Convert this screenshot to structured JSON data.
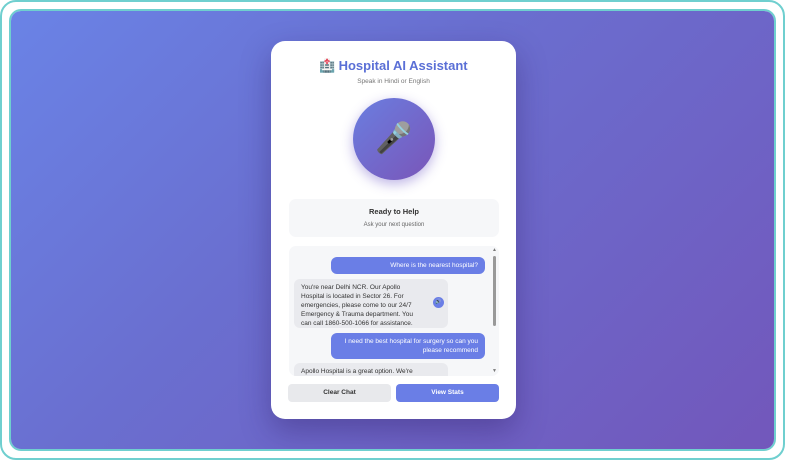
{
  "header": {
    "icon": "hospital-icon",
    "icon_glyph": "🏥",
    "title": "Hospital AI Assistant",
    "subtitle": "Speak in Hindi or English"
  },
  "mic": {
    "icon": "microphone-icon",
    "glyph": "🎤"
  },
  "status": {
    "title": "Ready to Help",
    "subtitle": "Ask your next question"
  },
  "chat": {
    "messages": [
      {
        "role": "user",
        "text": "Where is the nearest hospital?"
      },
      {
        "role": "assistant",
        "text": "You're near Delhi NCR. Our Apollo Hospital is located in Sector 26. For emergencies, please come to our 24/7 Emergency & Trauma department. You can call 1860-500-1066 for assistance.",
        "speaker_glyph": "🔊"
      },
      {
        "role": "user",
        "text": "I need the best hospital for surgery so can you please recommend"
      },
      {
        "role": "assistant",
        "text": "Apollo Hospital is a great option. We're"
      }
    ],
    "scroll_up_glyph": "▲",
    "scroll_down_glyph": "▼"
  },
  "actions": {
    "clear_label": "Clear Chat",
    "stats_label": "View Stats"
  },
  "colors": {
    "accent": "#6a7ee6",
    "title": "#5a6fd6",
    "gradient_start": "#6a83e6",
    "gradient_end": "#7257bb",
    "frame": "#6fcfcf"
  }
}
